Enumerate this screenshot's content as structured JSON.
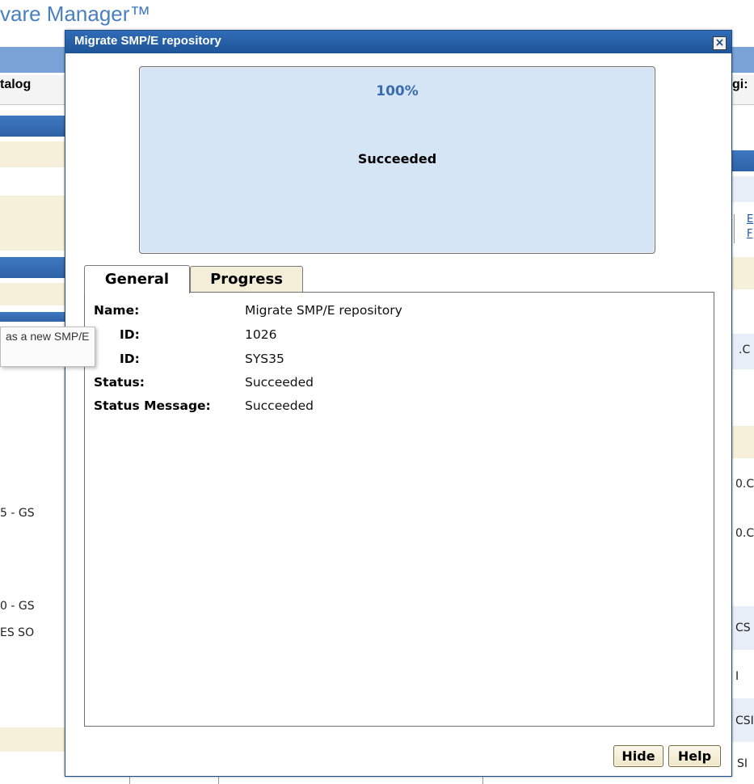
{
  "background": {
    "app_title": "vare Manager™",
    "tab_left": "talog",
    "tab_right": "gi:",
    "tooltip_text": "as a new SMP/E",
    "left_fragments": [
      "5 - GS",
      "0 - GS",
      "ES SO"
    ],
    "right_fragments": [
      ".C",
      "0.C",
      "0.C",
      "CS",
      "I",
      "CSI",
      "SI"
    ],
    "right_links": [
      "E",
      "F"
    ]
  },
  "dialog": {
    "title": "Migrate SMP/E repository",
    "close_label": "×",
    "progress": {
      "percent_text": "100%",
      "percent_value": 100,
      "status_text": "Succeeded"
    },
    "tabs": [
      {
        "label": "General",
        "selected": true
      },
      {
        "label": "Progress",
        "selected": false
      }
    ],
    "details": [
      {
        "label": "Name:",
        "value": "Migrate SMP/E repository"
      },
      {
        "label": "ID:",
        "value": "1026"
      },
      {
        "label": "ID:",
        "value": "SYS35"
      },
      {
        "label": "Status:",
        "value": "Succeeded"
      },
      {
        "label": "Status Message:",
        "value": "Succeeded"
      }
    ],
    "buttons": {
      "hide": "Hide",
      "help": "Help"
    }
  },
  "colors": {
    "title_bar": "#1f5497",
    "progress_box": "#d6e5f6",
    "percent_text": "#3a6db0",
    "beige": "#f6efd9",
    "app_title": "#4a7fc0"
  }
}
